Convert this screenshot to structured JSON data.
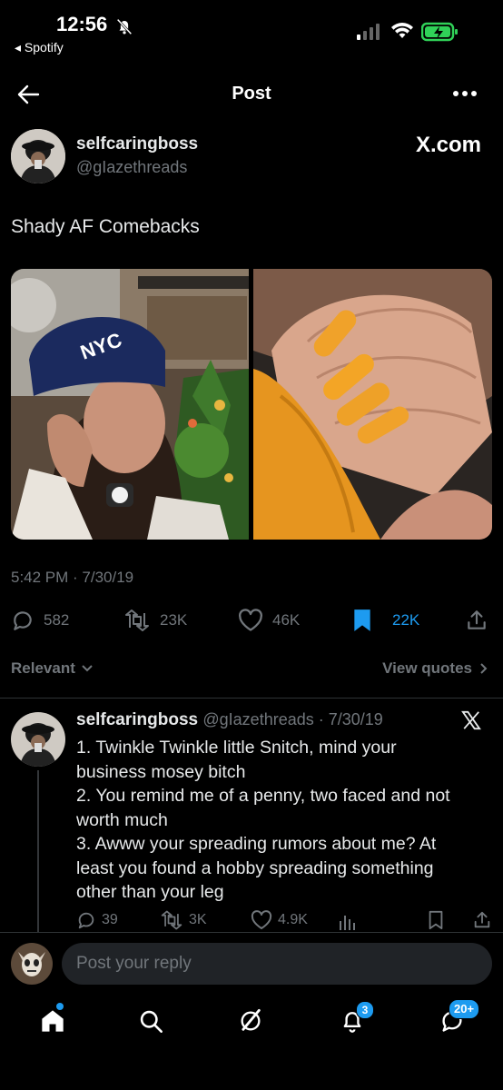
{
  "status_bar": {
    "time": "12:56",
    "back_app": "◂ Spotify"
  },
  "topbar": {
    "title": "Post"
  },
  "post": {
    "author_name": "selfcaringboss",
    "author_handle": "@gIazethreads",
    "source_badge": "X.com",
    "text": "Shady AF Comebacks",
    "timestamp": "5:42 PM · 7/30/19",
    "metrics": {
      "replies": "582",
      "reposts": "23K",
      "likes": "46K",
      "bookmarks": "22K"
    }
  },
  "sort": {
    "relevant_label": "Relevant",
    "view_quotes_label": "View quotes"
  },
  "reply": {
    "author_name": "selfcaringboss",
    "meta": "@gIazethreads · 7/30/19",
    "lines": [
      "1. Twinkle Twinkle little Snitch, mind your",
      "business mosey bitch",
      "2. You remind me of a penny, two faced and not",
      "worth much",
      "3. Awww your spreading rumors about me? At",
      "least you found a hobby spreading something",
      "other than your leg"
    ],
    "metrics": {
      "replies": "39",
      "reposts": "3K",
      "likes": "4.9K"
    }
  },
  "composer": {
    "placeholder": "Post your reply"
  },
  "tabbar": {
    "notifications_badge": "3",
    "messages_badge": "20+"
  },
  "colors": {
    "accent": "#1d9bf0",
    "background": "#000000",
    "text": "#e7e9ea",
    "muted": "#71767b"
  }
}
